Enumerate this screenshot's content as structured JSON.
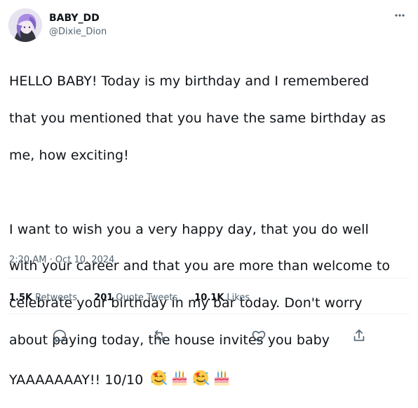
{
  "tweet": {
    "author": {
      "display_name": "BABY_DD",
      "handle": "@Dixie_Dion",
      "avatar": "avatar"
    },
    "text_lines": [
      "HELLO BABY! Today is my birthday and I remembered",
      "that you mentioned that you have the same birthday as",
      "me, how exciting!",
      "I want to wish you a very happy day, that you do well",
      "with your career and that you are more than welcome to",
      "celebrate your birthday in my bar today. Don't worry",
      "about paying today, the house invites you baby",
      "YAAAAAAAY!! 10/10"
    ],
    "emojis": [
      "🥳",
      "🎂",
      "🥳",
      "🎂"
    ],
    "timestamp": "2:20 AM · Oct 10, 2024",
    "stats": {
      "retweets_value": "1.5K",
      "retweets_label": "Retweets",
      "quote_tweets_value": "201",
      "quote_tweets_label": "Quote Tweets",
      "likes_value": "10.1K",
      "likes_label": "Likes"
    },
    "icons": {
      "more": "more-icon",
      "reply": "reply-icon",
      "retweet": "retweet-icon",
      "like": "heart-icon",
      "share": "share-icon"
    },
    "colors": {
      "text": "#0f1419",
      "muted": "#536471",
      "divider": "#eff3f4"
    }
  }
}
